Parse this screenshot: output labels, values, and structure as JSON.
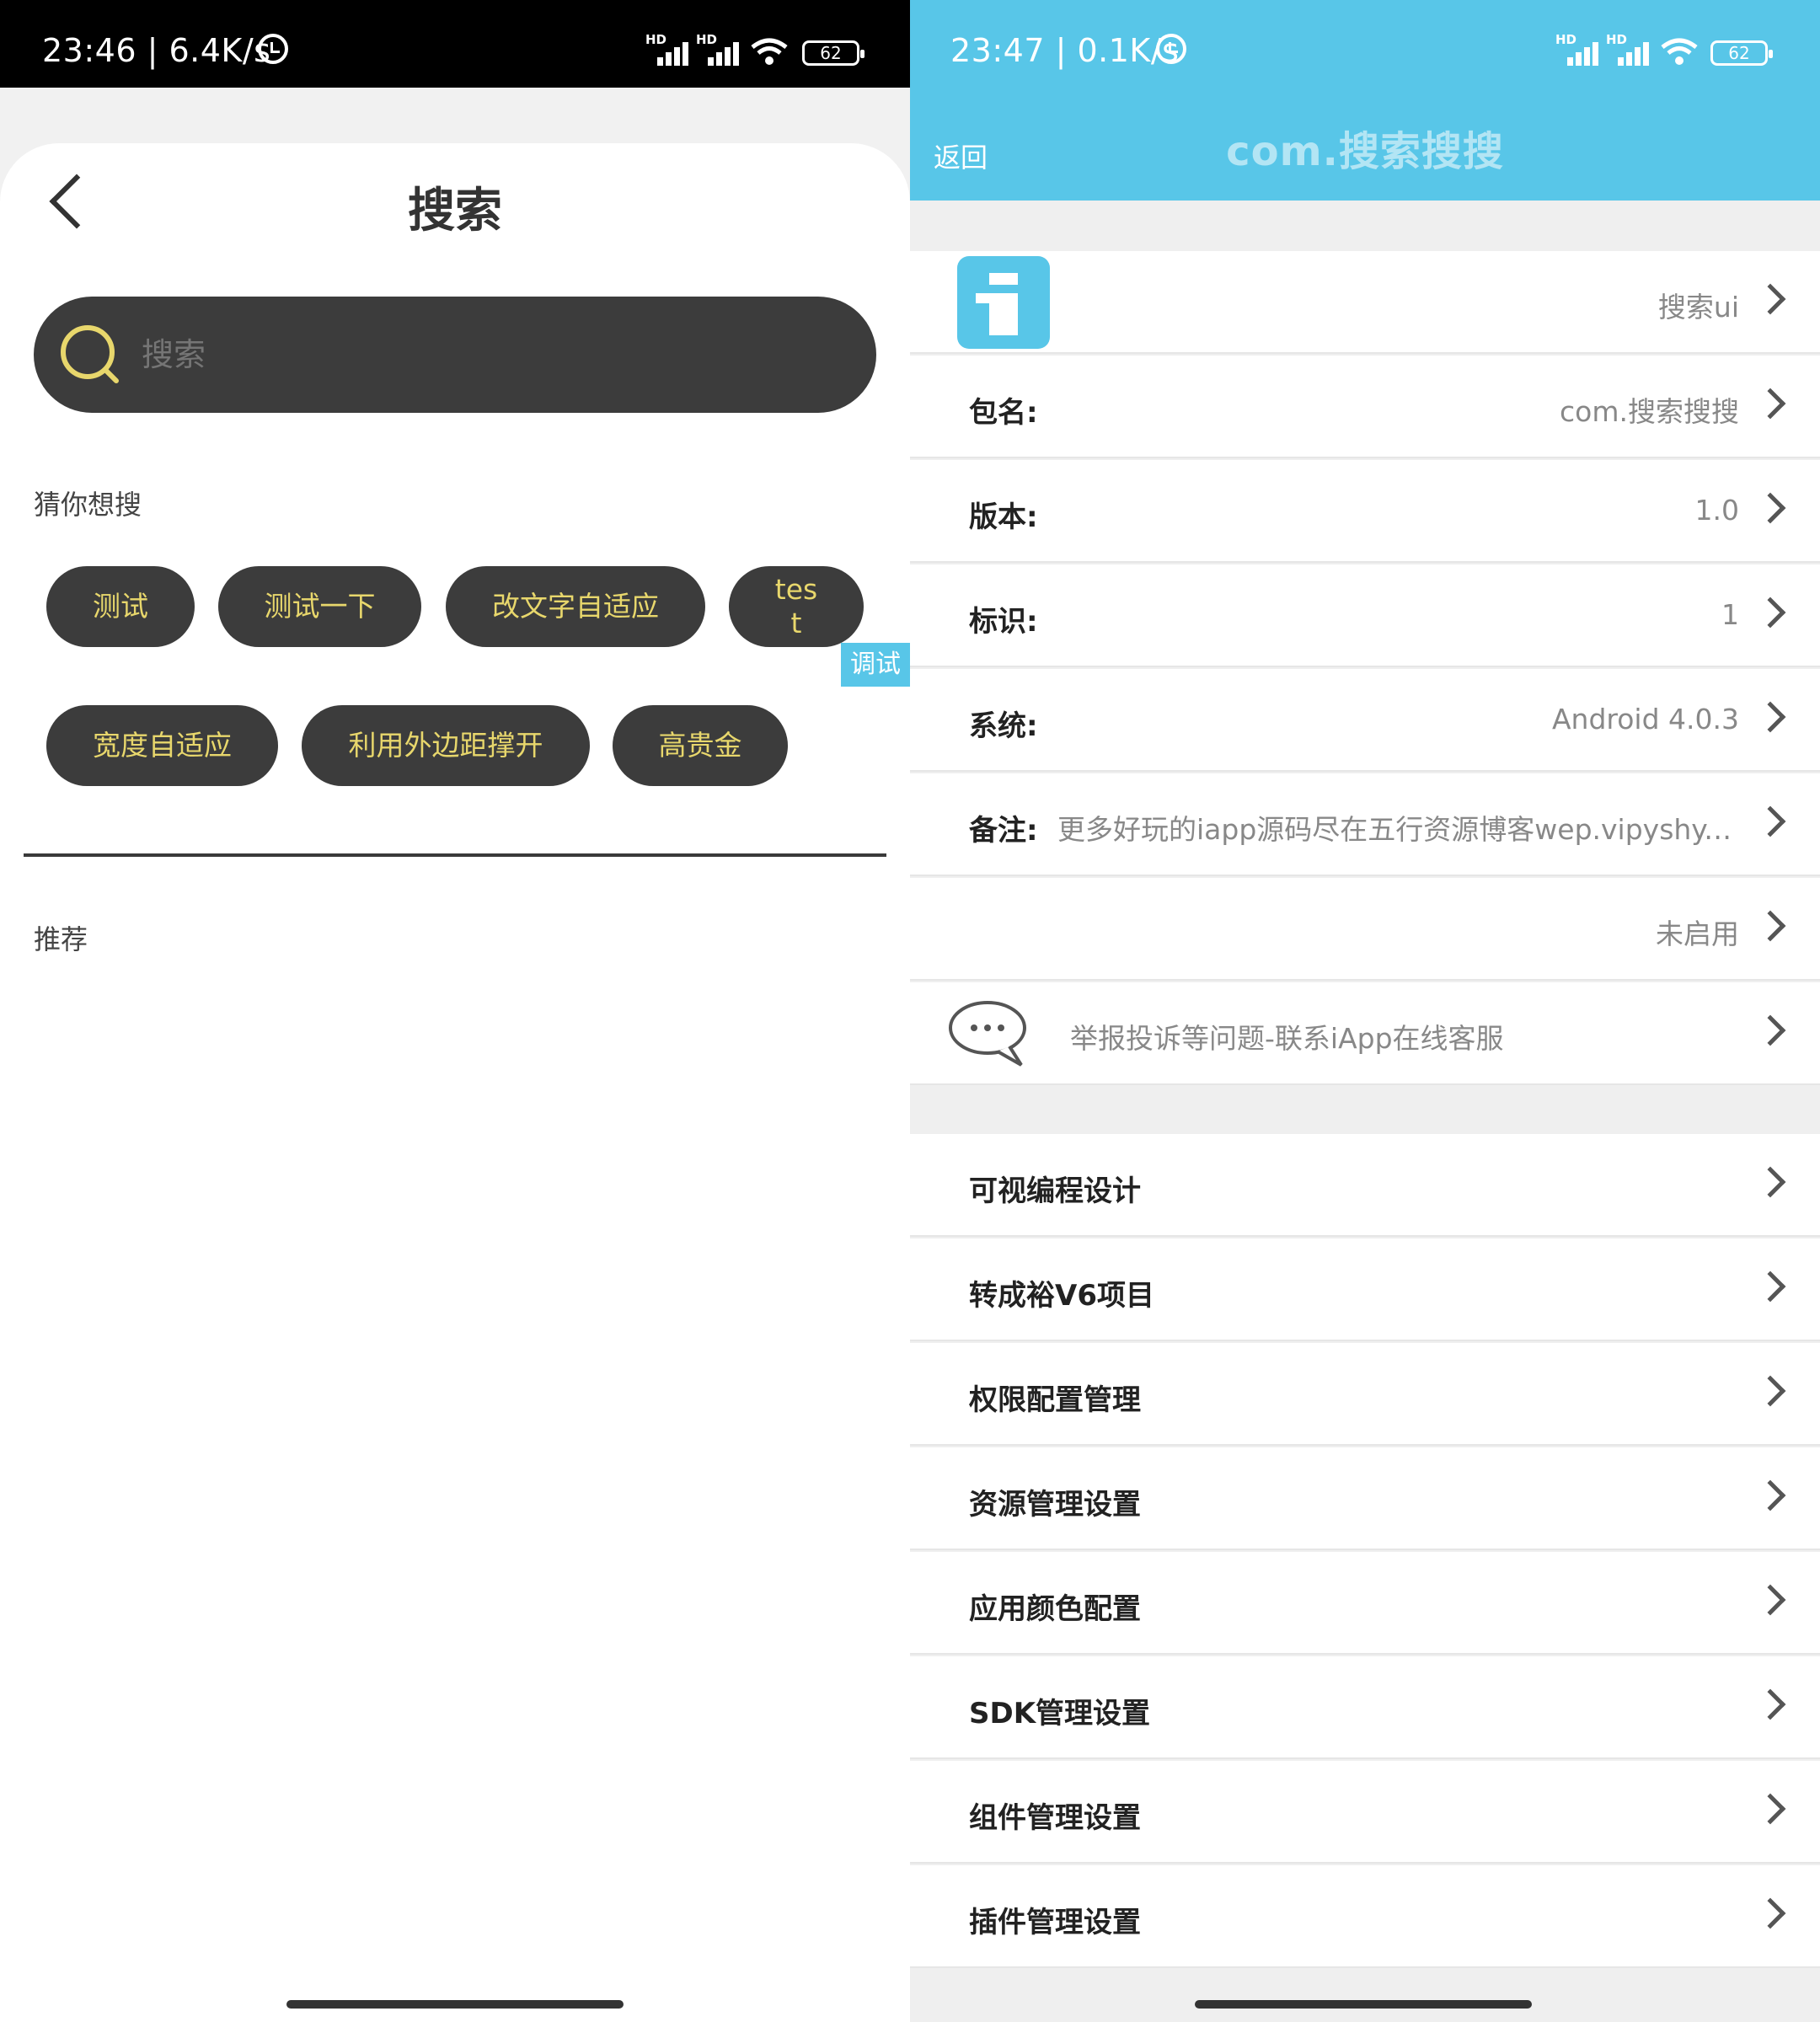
{
  "left": {
    "status": {
      "time": "23:46 | 6.4K/s",
      "battery": "62"
    },
    "title": "搜索",
    "search": {
      "placeholder": "搜索"
    },
    "suggest_label": "猜你想搜",
    "chips": [
      "测试",
      "测试一下",
      "改文字自适应",
      "tes\nt",
      "宽度自适应",
      "利用外边距撑开",
      "高贵金"
    ],
    "debug_tag": "调试",
    "recommend_label": "推荐"
  },
  "right": {
    "status": {
      "time": "23:47 | 0.1K/s",
      "battery": "62"
    },
    "back": "返回",
    "title": "com.搜索搜搜",
    "info_rows": [
      {
        "label": "",
        "value": "搜索ui"
      },
      {
        "label": "包名:",
        "value": "com.搜索搜搜"
      },
      {
        "label": "版本:",
        "value": "1.0"
      },
      {
        "label": "标识:",
        "value": "1"
      },
      {
        "label": "系统:",
        "value": "Android 4.0.3"
      },
      {
        "label": "备注:",
        "value": "更多好玩的iapp源码尽在五行资源博客wep.vipyshy.c..."
      },
      {
        "label": "",
        "value": "未启用"
      }
    ],
    "report": "举报投诉等问题-联系iApp在线客服",
    "menu": [
      "可视编程设计",
      "转成裕V6项目",
      "权限配置管理",
      "资源管理设置",
      "应用颜色配置",
      "SDK管理设置",
      "组件管理设置",
      "插件管理设置"
    ]
  },
  "colors": {
    "accent": "#58c6e8",
    "chip_bg": "#3c3c3c",
    "chip_text": "#e8d76c"
  }
}
